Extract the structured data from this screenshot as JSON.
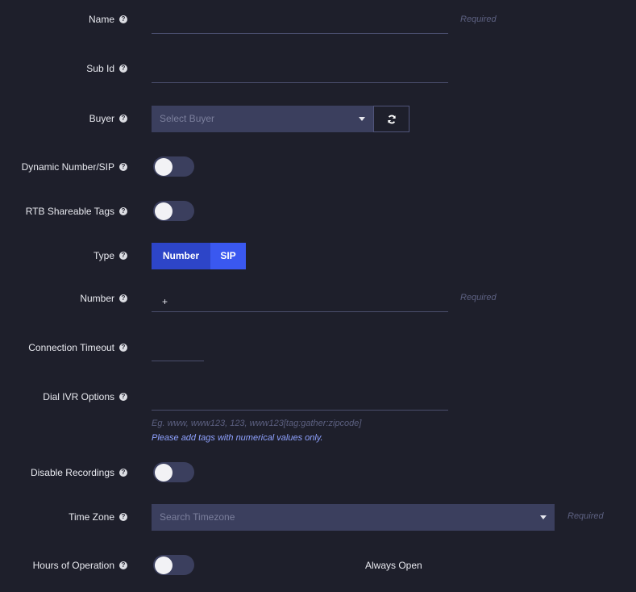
{
  "fields": {
    "name": {
      "label": "Name",
      "value": "",
      "required": "Required"
    },
    "sub_id": {
      "label": "Sub Id",
      "value": ""
    },
    "buyer": {
      "label": "Buyer",
      "placeholder": "Select Buyer",
      "refresh_icon": "refresh-icon"
    },
    "dynamic_number": {
      "label": "Dynamic Number/SIP",
      "on": false
    },
    "rtb_tags": {
      "label": "RTB Shareable Tags",
      "on": false
    },
    "type": {
      "label": "Type",
      "options": [
        "Number",
        "SIP"
      ],
      "selected": "SIP"
    },
    "number": {
      "label": "Number",
      "value": "+",
      "required": "Required"
    },
    "connection_timeout": {
      "label": "Connection Timeout",
      "value": ""
    },
    "dial_ivr": {
      "label": "Dial IVR Options",
      "value": "",
      "example": "Eg. www, www123, 123, www123[tag:gather:zipcode]",
      "note": "Please add tags with numerical values only."
    },
    "disable_recordings": {
      "label": "Disable Recordings",
      "on": false
    },
    "time_zone": {
      "label": "Time Zone",
      "placeholder": "Search Timezone",
      "required": "Required"
    },
    "hours": {
      "label": "Hours of Operation",
      "on": false,
      "status": "Always Open"
    }
  },
  "help_glyph": "?",
  "colors": {
    "background": "#1e1f2b",
    "input_fill": "#3b3f5e",
    "segment_primary": "#2d45c8",
    "segment_secondary": "#3a58f0",
    "note_blue": "#8fa2ff",
    "required_gray": "#5c6080"
  }
}
